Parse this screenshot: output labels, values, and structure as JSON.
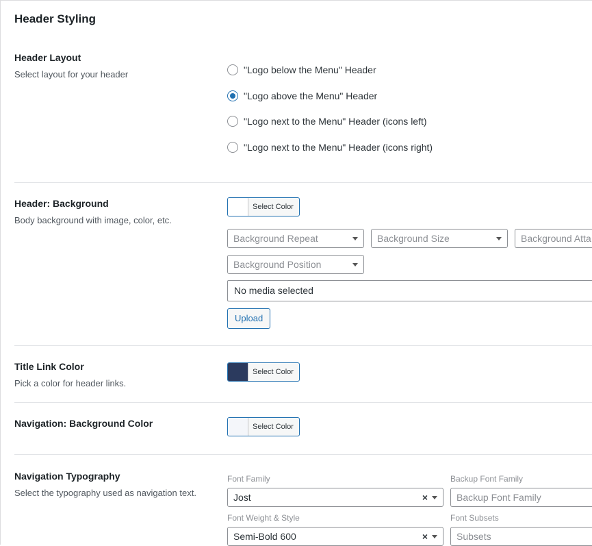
{
  "section_title": "Header Styling",
  "header_layout": {
    "label": "Header Layout",
    "description": "Select layout for your header",
    "options": [
      {
        "label": "\"Logo below the Menu\" Header",
        "checked": false
      },
      {
        "label": "\"Logo above the Menu\" Header",
        "checked": true
      },
      {
        "label": "\"Logo next to the Menu\" Header (icons left)",
        "checked": false
      },
      {
        "label": "\"Logo next to the Menu\" Header (icons right)",
        "checked": false
      }
    ]
  },
  "header_background": {
    "label": "Header: Background",
    "description": "Body background with image, color, etc.",
    "color_button": {
      "label": "Select Color",
      "swatch": "#ffffff"
    },
    "repeat_placeholder": "Background Repeat",
    "size_placeholder": "Background Size",
    "attachment_placeholder": "Background Atta",
    "position_placeholder": "Background Position",
    "media_text": "No media selected",
    "upload_label": "Upload"
  },
  "title_link_color": {
    "label": "Title Link Color",
    "description": "Pick a color for header links.",
    "color_button": {
      "label": "Select Color",
      "swatch": "#2b3a5e"
    }
  },
  "navigation_background": {
    "label": "Navigation: Background Color",
    "color_button": {
      "label": "Select Color",
      "swatch": "#f4f6fa"
    }
  },
  "navigation_typography": {
    "label": "Navigation Typography",
    "description": "Select the typography used as navigation text.",
    "font_family_label": "Font Family",
    "font_family_value": "Jost",
    "backup_font_label": "Backup Font Family",
    "backup_font_placeholder": "Backup Font Family",
    "weight_label": "Font Weight & Style",
    "weight_value": "Semi-Bold 600",
    "subsets_label": "Font Subsets",
    "subsets_placeholder": "Subsets",
    "clear_glyph": "×"
  },
  "colors": {
    "accent": "#2271b1"
  }
}
